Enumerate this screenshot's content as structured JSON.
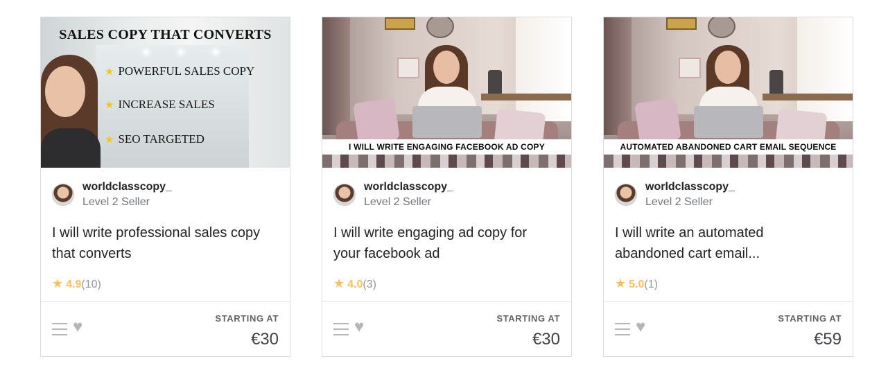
{
  "colors": {
    "star": "#ffbe5b",
    "border": "#dadbdd",
    "text": "#222325",
    "muted": "#74767e"
  },
  "gigs": [
    {
      "thumbnail": {
        "title": "SALES COPY THAT CONVERTS",
        "bullets": [
          "POWERFUL SALES COPY",
          "INCREASE SALES",
          "SEO TARGETED"
        ]
      },
      "seller": {
        "name": "worldclasscopy_",
        "level": "Level 2 Seller"
      },
      "title": "I will write professional sales copy that converts",
      "rating": {
        "score": "4.9",
        "count": "(10)"
      },
      "starting_label": "STARTING AT",
      "price": "€30",
      "icons": [
        "menu-icon",
        "heart-icon",
        "star-icon"
      ]
    },
    {
      "thumbnail": {
        "banner": "I WILL WRITE ENGAGING FACEBOOK AD COPY"
      },
      "seller": {
        "name": "worldclasscopy_",
        "level": "Level 2 Seller"
      },
      "title": "I will write engaging ad copy for your facebook ad",
      "rating": {
        "score": "4.0",
        "count": "(3)"
      },
      "starting_label": "STARTING AT",
      "price": "€30",
      "icons": [
        "menu-icon",
        "heart-icon",
        "star-icon"
      ]
    },
    {
      "thumbnail": {
        "banner": "AUTOMATED ABANDONED CART EMAIL SEQUENCE"
      },
      "seller": {
        "name": "worldclasscopy_",
        "level": "Level 2 Seller"
      },
      "title": "I will write an automated abandoned cart email...",
      "rating": {
        "score": "5.0",
        "count": "(1)"
      },
      "starting_label": "STARTING AT",
      "price": "€59",
      "icons": [
        "menu-icon",
        "heart-icon",
        "star-icon"
      ]
    }
  ]
}
